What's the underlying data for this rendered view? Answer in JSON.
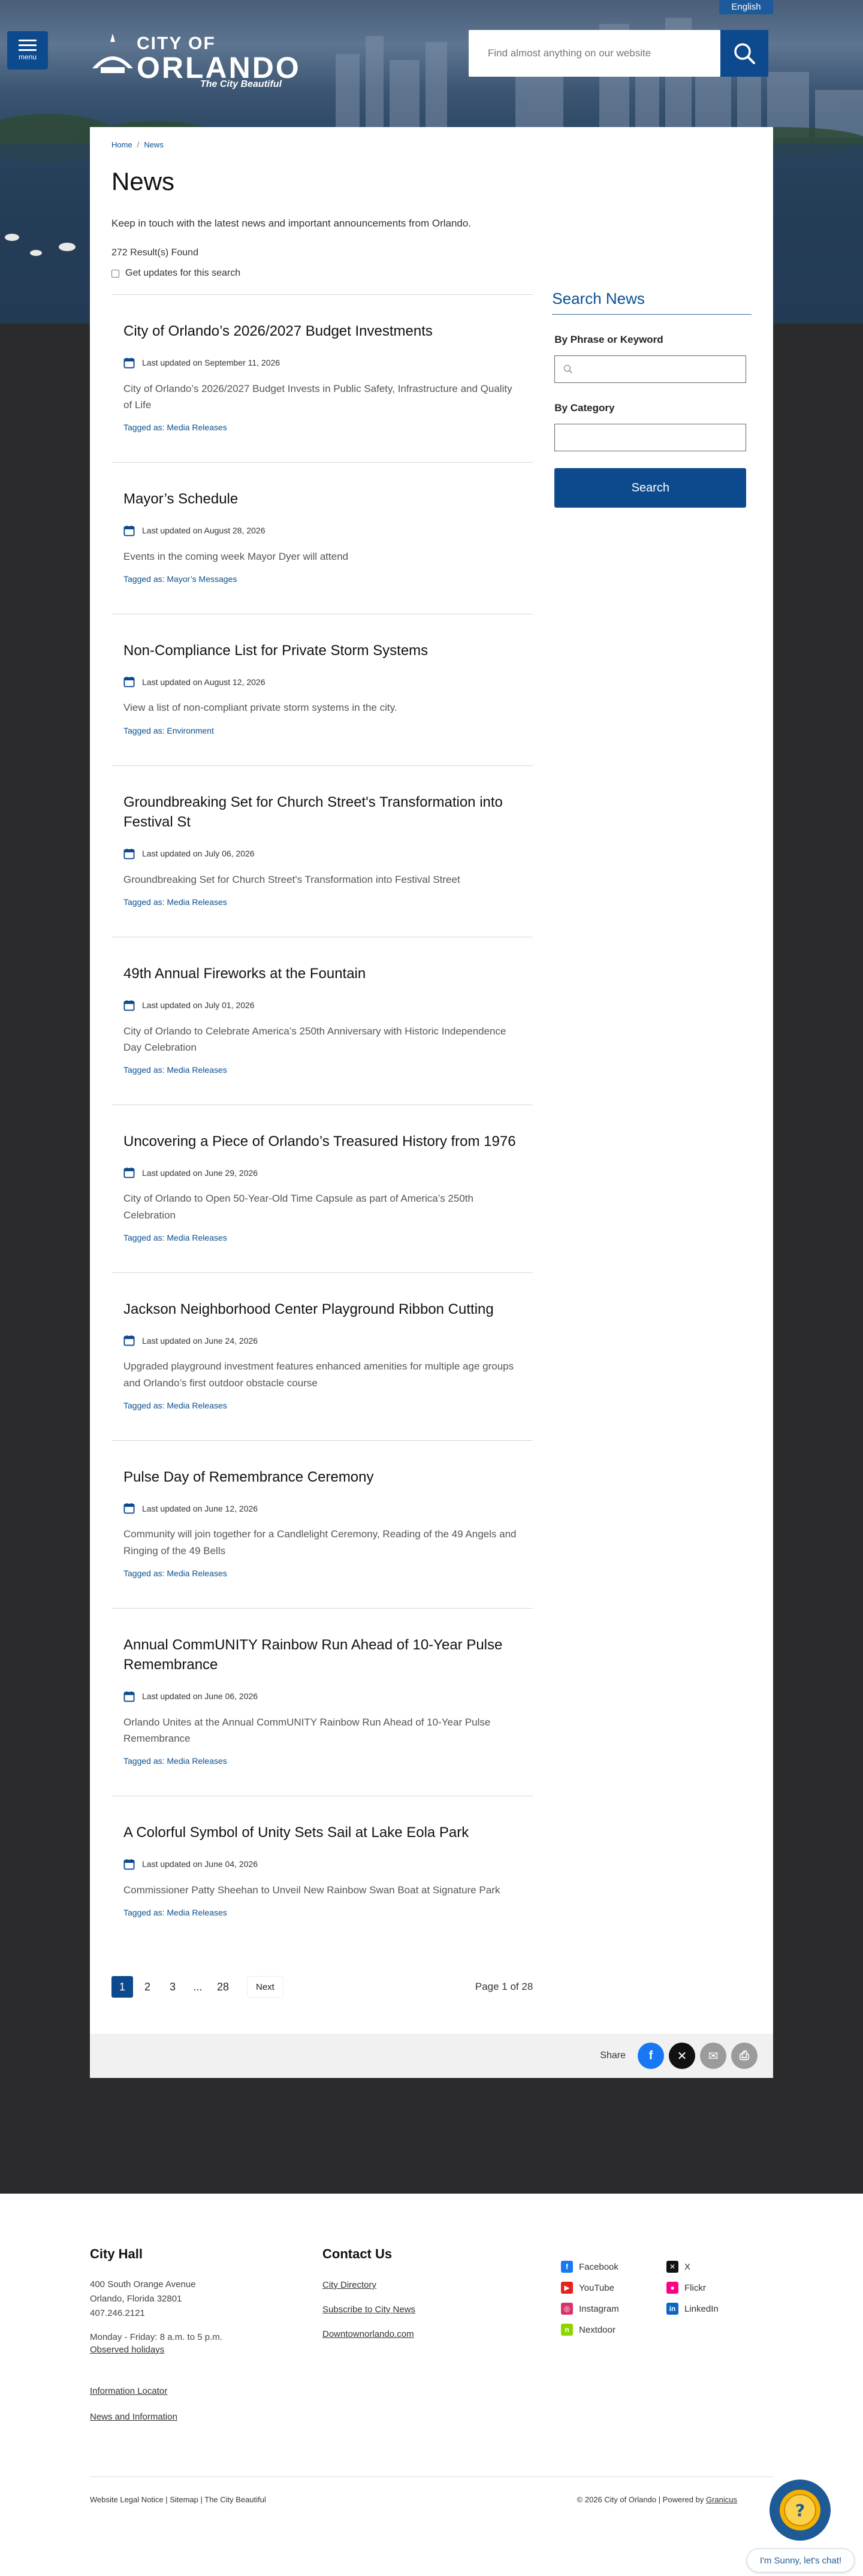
{
  "header": {
    "language": "English",
    "menu_label": "menu",
    "logo": {
      "city": "CITY OF",
      "name": "ORLANDO",
      "tagline": "The City Beautiful"
    },
    "search_placeholder": "Find almost anything on our website"
  },
  "breadcrumb": {
    "home": "Home",
    "current": "News"
  },
  "page": {
    "title": "News",
    "intro": "Keep in touch with the latest news and important announcements from Orlando.",
    "results": "272 Result(s) Found",
    "updates_label": "Get updates for this search"
  },
  "news": [
    {
      "title": "City of Orlando’s 2026/2027 Budget Investments",
      "date": "Last updated on September 11, 2026",
      "summary": "City of Orlando’s 2026/2027 Budget Invests in Public Safety, Infrastructure and Quality of Life",
      "tag": "Tagged as: Media Releases"
    },
    {
      "title": "Mayor’s Schedule",
      "date": "Last updated on August 28, 2026",
      "summary": "Events in the coming week Mayor Dyer will attend",
      "tag": "Tagged as: Mayor’s Messages"
    },
    {
      "title": "Non-Compliance List for Private Storm Systems",
      "date": "Last updated on August 12, 2026",
      "summary": "View a list of non-compliant private storm systems in the city.",
      "tag": "Tagged as: Environment"
    },
    {
      "title": "Groundbreaking Set for Church Street's Transformation into Festival St",
      "date": "Last updated on July 06, 2026",
      "summary": "Groundbreaking Set for Church Street's Transformation into Festival Street",
      "tag": "Tagged as: Media Releases"
    },
    {
      "title": "49th Annual Fireworks at the Fountain",
      "date": "Last updated on July 01, 2026",
      "summary": "City of Orlando to Celebrate America’s 250th Anniversary with Historic Independence Day Celebration",
      "tag": "Tagged as: Media Releases"
    },
    {
      "title": "Uncovering a Piece of Orlando’s Treasured History from 1976",
      "date": "Last updated on June 29, 2026",
      "summary": "City of Orlando to Open 50-Year-Old Time Capsule as part of America’s 250th Celebration",
      "tag": "Tagged as: Media Releases"
    },
    {
      "title": "Jackson Neighborhood Center Playground Ribbon Cutting",
      "date": "Last updated on June 24, 2026",
      "summary": "Upgraded playground investment features enhanced amenities for multiple age groups and Orlando’s first outdoor obstacle course",
      "tag": "Tagged as: Media Releases"
    },
    {
      "title": "Pulse Day of Remembrance Ceremony",
      "date": "Last updated on June 12, 2026",
      "summary": "Community will join together for a Candlelight Ceremony, Reading of the 49 Angels and Ringing of the 49 Bells",
      "tag": "Tagged as: Media Releases"
    },
    {
      "title": "Annual CommUNITY Rainbow Run Ahead of 10-Year Pulse Remembrance",
      "date": "Last updated on June 06, 2026",
      "summary": "Orlando Unites at the Annual CommUNITY Rainbow Run Ahead of 10-Year Pulse Remembrance",
      "tag": "Tagged as: Media Releases"
    },
    {
      "title": "A Colorful Symbol of Unity Sets Sail at Lake Eola Park",
      "date": "Last updated on June 04, 2026",
      "summary": "Commissioner Patty Sheehan to Unveil New Rainbow Swan Boat at Signature Park",
      "tag": "Tagged as: Media Releases"
    }
  ],
  "sidebar": {
    "title": "Search News",
    "phrase_label": "By Phrase or Keyword",
    "category_label": "By Category",
    "button": "Search"
  },
  "pagination": {
    "pages": [
      "1",
      "2",
      "3",
      "...",
      "28"
    ],
    "next": "Next",
    "info": "Page 1 of 28"
  },
  "share": {
    "label": "Share"
  },
  "footer": {
    "cityhall": {
      "title": "City Hall",
      "address1": "400 South Orange Avenue",
      "address2": "Orlando, Florida 32801",
      "phone": "407.246.2121",
      "hours": "Monday - Friday: 8 a.m. to 5 p.m.",
      "holidays": "Observed holidays",
      "locator": "Information Locator",
      "news": "News and Information"
    },
    "contact": {
      "title": "Contact Us",
      "directory": "City Directory",
      "subscribe": "Subscribe to City News",
      "downtown": "Downtownorlando.com"
    },
    "social": {
      "facebook": "Facebook",
      "youtube": "YouTube",
      "instagram": "Instagram",
      "nextdoor": "Nextdoor",
      "x": "X",
      "flickr": "Flickr",
      "linkedin": "LinkedIn"
    },
    "legal": "Website Legal Notice | Sitemap | The City Beautiful",
    "copyright": "© 2026 City of Orlando | Powered by",
    "powered": "Granicus",
    "chat": "I'm Sunny, let's chat!"
  },
  "colors": {
    "primary": "#0d4a8d",
    "link": "#0a4f8f",
    "dark_bg": "#2b2b2e"
  }
}
